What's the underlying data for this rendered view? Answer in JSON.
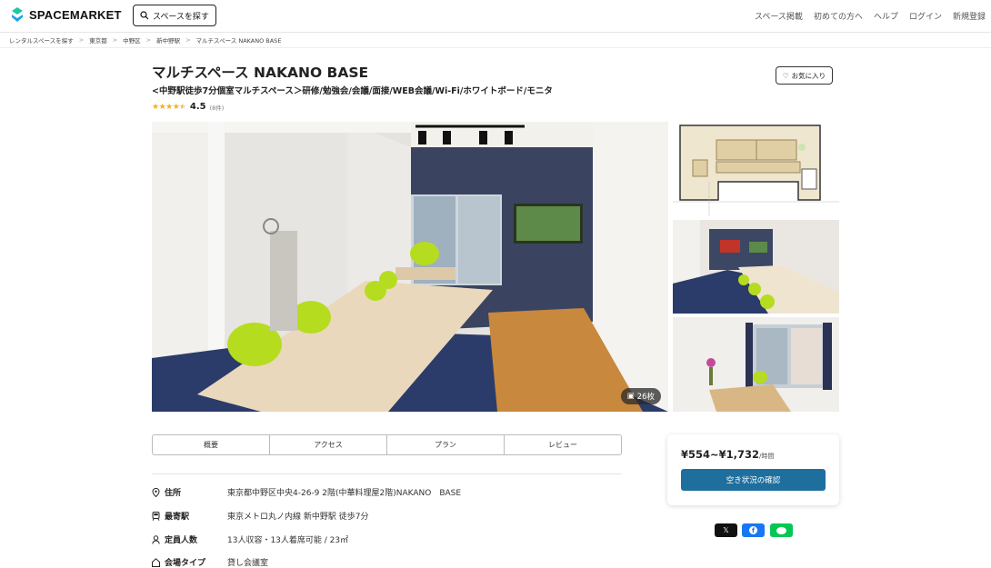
{
  "header": {
    "logo_text": "SPACEMARKET",
    "search_label": "スペースを探す",
    "nav": [
      "スペース掲載",
      "初めての方へ",
      "ヘルプ",
      "ログイン",
      "新規登録"
    ]
  },
  "breadcrumbs": [
    "レンタルスペースを探す",
    "東京都",
    "中野区",
    "新中野駅",
    "マルチスペース NAKANO BASE"
  ],
  "listing": {
    "title": "マルチスペース NAKANO BASE",
    "subtitle": "<中野駅徒歩7分個室マルチスペース＞研修/勉強会/会議/面接/WEB会議/Wi-Fi/ホワイトボード/モニタ",
    "rating": "4.5",
    "rating_count": "(8件)",
    "stars": 4.5,
    "favorite_label": "お気に入り",
    "photo_count": "26枚"
  },
  "tabs": [
    "概要",
    "アクセス",
    "プラン",
    "レビュー"
  ],
  "info": [
    {
      "icon": "pin-icon",
      "label": "住所",
      "value": "東京都中野区中央4-26-9 2階(中華料理屋2階)NAKANO　BASE"
    },
    {
      "icon": "train-icon",
      "label": "最寄駅",
      "value": "東京メトロ丸ノ内線 新中野駅 徒歩7分"
    },
    {
      "icon": "person-icon",
      "label": "定員人数",
      "value": "13人収容・13人着席可能 / 23㎡"
    },
    {
      "icon": "building-icon",
      "label": "会場タイプ",
      "value": "貸し会議室"
    }
  ],
  "booking": {
    "price": "¥554~¥1,732",
    "price_unit": "/時間",
    "availability_button": "空き状況の確認"
  },
  "share": {
    "x": "𝕏",
    "facebook": "f",
    "line": "LINE"
  },
  "colors": {
    "accent": "#1f6f9e",
    "star": "#f3b21a",
    "line_green": "#06c755",
    "facebook_blue": "#1877f2"
  }
}
